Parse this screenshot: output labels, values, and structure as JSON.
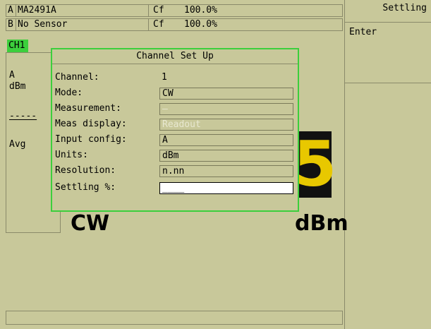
{
  "sensor_a": {
    "prefix": "A",
    "model": "MA2491A",
    "cf_label": "Cf",
    "cf_value": "100.0%"
  },
  "sensor_b": {
    "prefix": "B",
    "model": "No Sensor",
    "cf_label": "Cf",
    "cf_value": "100.0%"
  },
  "channel_tag": "CH1",
  "left_panel": {
    "sensor": "A",
    "unit": "dBm",
    "dashes": "-----",
    "avg": "Avg"
  },
  "display": {
    "big_digit": "5",
    "mode_text": "CW",
    "unit_text": "dBm"
  },
  "softkeys": {
    "title": "Settling",
    "enter": "Enter"
  },
  "dialog": {
    "title": "Channel Set Up",
    "channel": {
      "label": "Channel:",
      "value": "1"
    },
    "mode": {
      "label": "Mode:",
      "value": "CW"
    },
    "measurement": {
      "label": "Measurement:",
      "value": "—"
    },
    "meas_display": {
      "label": "Meas display:",
      "value": "Readout"
    },
    "input_config": {
      "label": "Input config:",
      "value": "A"
    },
    "units": {
      "label": "Units:",
      "value": "dBm"
    },
    "resolution": {
      "label": "Resolution:",
      "value": "n.nn"
    },
    "settling": {
      "label": "Settling %:",
      "value": "____"
    }
  },
  "colors": {
    "background": "#c8c89a",
    "dialog_border": "#3ccf3c",
    "readout_bg": "#111111",
    "readout_digit": "#e8c800"
  }
}
